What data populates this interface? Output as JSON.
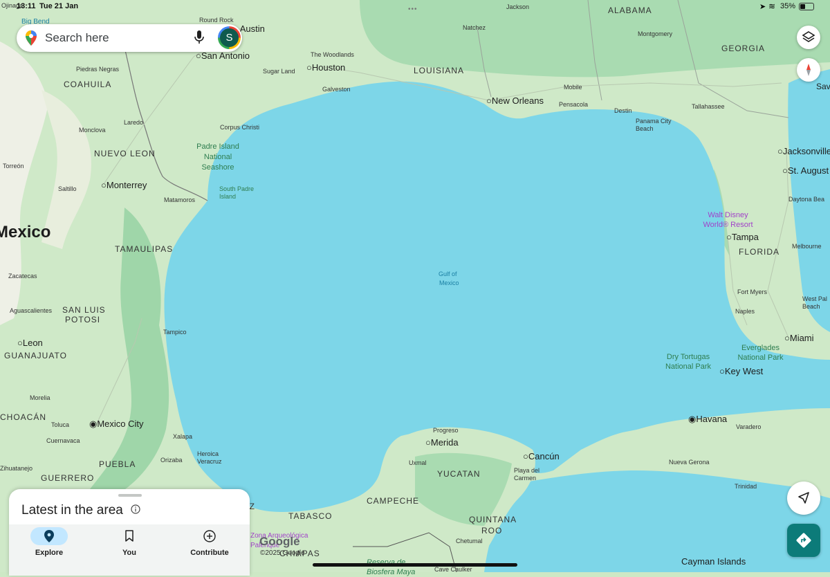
{
  "status_bar": {
    "time": "13:11",
    "date": "Tue 21 Jan",
    "battery": "35%"
  },
  "search": {
    "placeholder": "Search here",
    "avatar_letter": "S"
  },
  "map": {
    "water_label": [
      "Gulf of",
      "Mexico"
    ],
    "country": "Mexico",
    "regions": [
      "COAHUILA",
      "NUEVO LEON",
      "TAMAULIPAS",
      "SAN LUIS",
      "POTOSI",
      "GUANAJUATO",
      "CHOACÁN",
      "PUEBLA",
      "GUERRERO",
      "VERACRUZ",
      "TABASCO",
      "CAMPECHE",
      "YUCATAN",
      "QUINTANA",
      "ROO",
      "CHIAPAS",
      "LOUISIANA",
      "ALABAMA",
      "GEORGIA",
      "FLORIDA"
    ],
    "cities_major": [
      "Austin",
      "San Antonio",
      "Houston",
      "New Orleans",
      "Monterrey",
      "Mexico City",
      "Leon",
      "Merida",
      "Cancún",
      "Havana",
      "Tampa",
      "Miami",
      "Key West",
      "Jacksonville",
      "St. August"
    ],
    "cities_minor": [
      "Round Rock",
      "The Woodlands",
      "Sugar Land",
      "Galveston",
      "Natchez",
      "Jackson",
      "Montgomery",
      "Mobile",
      "Pensacola",
      "Destin",
      "Panama City Beach",
      "Tallahassee",
      "Daytona Bea",
      "Melbourne",
      "Fort Myers",
      "Naples",
      "West Pal Beach",
      "Corpus Christi",
      "Laredo",
      "Monclova",
      "Saltillo",
      "Matamoros",
      "Torreón",
      "Piedras Negras",
      "Zacatecas",
      "Morelia",
      "Aguascalientes",
      "Tampico",
      "Toluca",
      "Cuernavaca",
      "Xalapa",
      "Orizaba",
      "Heroica Veracruz",
      "Zihuatanejo",
      "Progreso",
      "Uxmal",
      "Playa del Carmen",
      "Chetumal",
      "Varadero",
      "Nueva Gerona",
      "Trinidad",
      "Cave Caulker",
      "Big Bend",
      "Ojinaga",
      "Savannah"
    ],
    "parks": [
      "Padre Island National Seashore",
      "South Padre Island",
      "Dry Tortugas National Park",
      "Everglades National Park",
      "Walt Disney World® Resort",
      "Reserva de Biosfera Maya",
      "Zona Arqueológica Palenque"
    ],
    "other": [
      "Cayman Islands"
    ]
  },
  "google": {
    "logo": "Google",
    "copyright": "©2025 Google"
  },
  "sheet": {
    "title": "Latest in the area",
    "tabs": [
      {
        "label": "Explore"
      },
      {
        "label": "You"
      },
      {
        "label": "Contribute"
      }
    ]
  },
  "colors": {
    "water": "#7dd6e8",
    "land": "#cfe9c8",
    "land_dark": "#9fd6a9",
    "desert": "#eef0e6",
    "accent": "#0c7b79",
    "tab_active": "#c2e7ff"
  },
  "icons": [
    "maps-pin-icon",
    "mic-icon",
    "layers-icon",
    "compass-icon",
    "navigate-icon",
    "directions-icon",
    "info-icon",
    "explore-pin-icon",
    "bookmark-icon",
    "add-circle-icon"
  ]
}
